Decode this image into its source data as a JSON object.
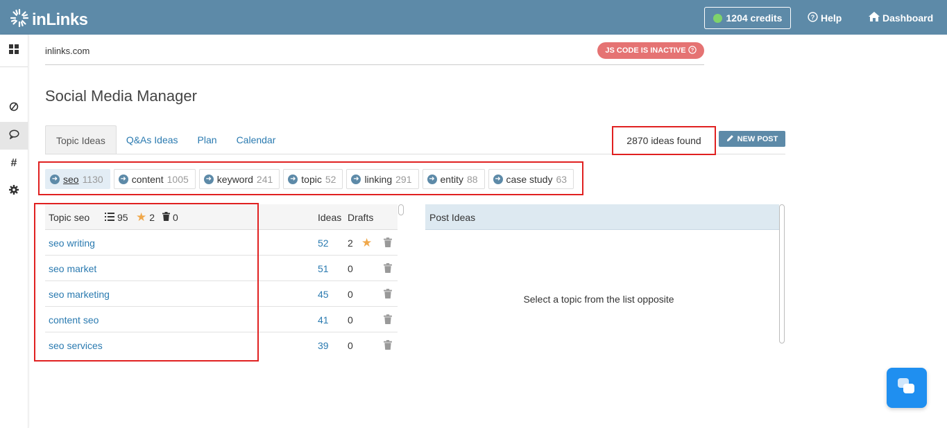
{
  "header": {
    "logo_text": "inLinks",
    "credits_label": "1204 credits",
    "help_label": "Help",
    "dashboard_label": "Dashboard",
    "credit_status_color": "#7fd36b",
    "brand_color": "#5d8aa8"
  },
  "sidebar": {
    "icons": [
      "grid-icon",
      "no-entry-icon",
      "comment-icon",
      "hashtag-icon",
      "gear-icon"
    ],
    "active": "comment-icon"
  },
  "site": {
    "domain": "inlinks.com",
    "js_status": "JS CODE IS INACTIVE"
  },
  "page": {
    "title": "Social Media Manager"
  },
  "tabs": [
    {
      "label": "Topic Ideas",
      "active": true
    },
    {
      "label": "Q&As Ideas",
      "active": false
    },
    {
      "label": "Plan",
      "active": false
    },
    {
      "label": "Calendar",
      "active": false
    }
  ],
  "ideas_found": "2870 ideas found",
  "new_post_label": "NEW POST",
  "chips": [
    {
      "label": "seo",
      "count": "1130",
      "active": true
    },
    {
      "label": "content",
      "count": "1005",
      "active": false
    },
    {
      "label": "keyword",
      "count": "241",
      "active": false
    },
    {
      "label": "topic",
      "count": "52",
      "active": false
    },
    {
      "label": "linking",
      "count": "291",
      "active": false
    },
    {
      "label": "entity",
      "count": "88",
      "active": false
    },
    {
      "label": "case study",
      "count": "63",
      "active": false
    }
  ],
  "topic_table": {
    "title_prefix": "Topic",
    "title_topic": "seo",
    "list_count": "95",
    "star_count": "2",
    "trash_count": "0",
    "col_ideas": "Ideas",
    "col_drafts": "Drafts",
    "rows": [
      {
        "name": "seo writing",
        "ideas": "52",
        "drafts": "2",
        "starred": true
      },
      {
        "name": "seo market",
        "ideas": "51",
        "drafts": "0",
        "starred": false
      },
      {
        "name": "seo marketing",
        "ideas": "45",
        "drafts": "0",
        "starred": false
      },
      {
        "name": "content seo",
        "ideas": "41",
        "drafts": "0",
        "starred": false
      },
      {
        "name": "seo services",
        "ideas": "39",
        "drafts": "0",
        "starred": false
      }
    ]
  },
  "post_ideas": {
    "header": "Post Ideas",
    "empty_message": "Select a topic from the list opposite"
  }
}
